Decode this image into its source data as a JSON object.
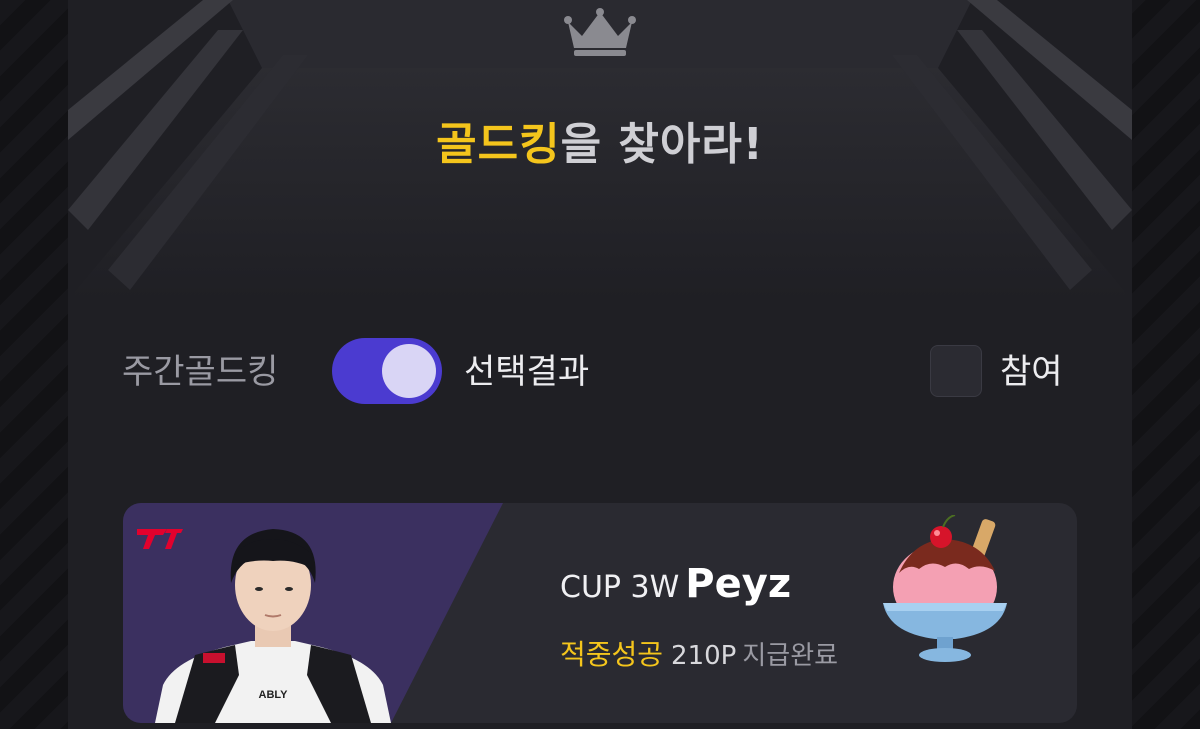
{
  "header": {
    "title_accent": "골드킹",
    "title_rest": "을 찾아라!"
  },
  "controls": {
    "weekly_label": "주간골드킹",
    "toggle_on": true,
    "result_label": "선택결과",
    "participate_checked": false,
    "participate_label": "참여"
  },
  "result_card": {
    "cup": "CUP 3W",
    "player": "Peyz",
    "status": "적중성공",
    "points": "210P",
    "payout": "지급완료",
    "jersey_sponsor": "ABLY"
  },
  "colors": {
    "accent_gold": "#f4c51c",
    "toggle": "#4b3bd0",
    "card_purple": "#3b3060",
    "panel": "#1f1f24"
  },
  "icons": [
    "crown-icon",
    "t1-logo-icon",
    "ice-cream-icon"
  ]
}
